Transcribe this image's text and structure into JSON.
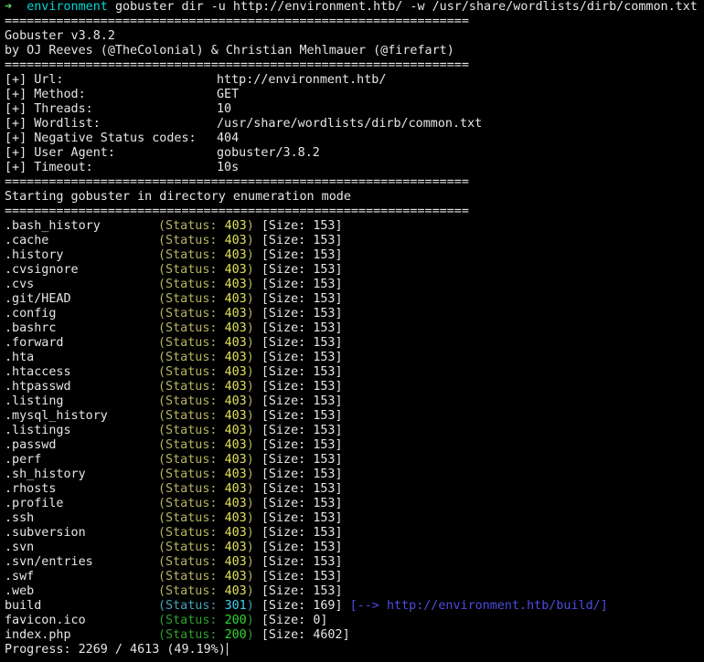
{
  "prompt": {
    "arrow": "➜",
    "cwd": "environment",
    "command": "gobuster dir -u http://environment.htb/ -w /usr/share/wordlists/dirb/common.txt"
  },
  "separator": "===============================================================",
  "banner": {
    "title": "Gobuster v3.8.2",
    "authors": "by OJ Reeves (@TheColonial) & Christian Mehlmauer (@firefart)"
  },
  "config": [
    {
      "label": "[+] Url:",
      "value": "http://environment.htb/"
    },
    {
      "label": "[+] Method:",
      "value": "GET"
    },
    {
      "label": "[+] Threads:",
      "value": "10"
    },
    {
      "label": "[+] Wordlist:",
      "value": "/usr/share/wordlists/dirb/common.txt"
    },
    {
      "label": "[+] Negative Status codes:",
      "value": "404"
    },
    {
      "label": "[+] User Agent:",
      "value": "gobuster/3.8.2"
    },
    {
      "label": "[+] Timeout:",
      "value": "10s"
    }
  ],
  "start_message": "Starting gobuster in directory enumeration mode",
  "results": [
    {
      "path": ".bash_history",
      "status": "403",
      "size": "153"
    },
    {
      "path": ".cache",
      "status": "403",
      "size": "153"
    },
    {
      "path": ".history",
      "status": "403",
      "size": "153"
    },
    {
      "path": ".cvsignore",
      "status": "403",
      "size": "153"
    },
    {
      "path": ".cvs",
      "status": "403",
      "size": "153"
    },
    {
      "path": ".git/HEAD",
      "status": "403",
      "size": "153"
    },
    {
      "path": ".config",
      "status": "403",
      "size": "153"
    },
    {
      "path": ".bashrc",
      "status": "403",
      "size": "153"
    },
    {
      "path": ".forward",
      "status": "403",
      "size": "153"
    },
    {
      "path": ".hta",
      "status": "403",
      "size": "153"
    },
    {
      "path": ".htaccess",
      "status": "403",
      "size": "153"
    },
    {
      "path": ".htpasswd",
      "status": "403",
      "size": "153"
    },
    {
      "path": ".listing",
      "status": "403",
      "size": "153"
    },
    {
      "path": ".mysql_history",
      "status": "403",
      "size": "153"
    },
    {
      "path": ".listings",
      "status": "403",
      "size": "153"
    },
    {
      "path": ".passwd",
      "status": "403",
      "size": "153"
    },
    {
      "path": ".perf",
      "status": "403",
      "size": "153"
    },
    {
      "path": ".sh_history",
      "status": "403",
      "size": "153"
    },
    {
      "path": ".rhosts",
      "status": "403",
      "size": "153"
    },
    {
      "path": ".profile",
      "status": "403",
      "size": "153"
    },
    {
      "path": ".ssh",
      "status": "403",
      "size": "153"
    },
    {
      "path": ".subversion",
      "status": "403",
      "size": "153"
    },
    {
      "path": ".svn",
      "status": "403",
      "size": "153"
    },
    {
      "path": ".svn/entries",
      "status": "403",
      "size": "153"
    },
    {
      "path": ".swf",
      "status": "403",
      "size": "153"
    },
    {
      "path": ".web",
      "status": "403",
      "size": "153"
    },
    {
      "path": "build",
      "status": "301",
      "size": "169",
      "redirect": "http://environment.htb/build/"
    },
    {
      "path": "favicon.ico",
      "status": "200",
      "size": "0"
    },
    {
      "path": "index.php",
      "status": "200",
      "size": "4602"
    }
  ],
  "progress": {
    "text": "Progress: 2269 / 4613 (49.19%)"
  },
  "colors": {
    "background": "#000000",
    "foreground": "#e6e6e6",
    "prompt_arrow": "#5fd75f",
    "prompt_cwd": "#00d7d7",
    "status_403": "#e0e05a",
    "status_301": "#3fd0f0",
    "status_200": "#33d633",
    "redirect": "#4c4ce0"
  }
}
